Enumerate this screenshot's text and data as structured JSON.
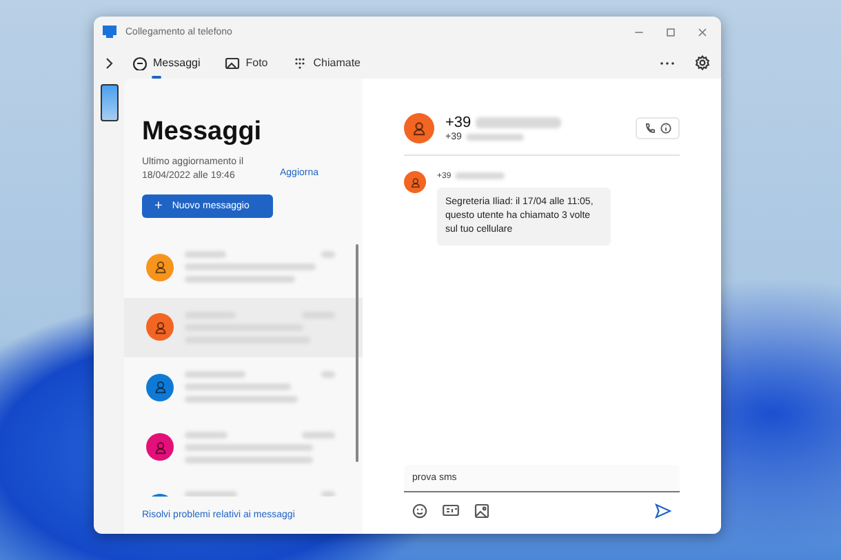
{
  "window": {
    "title": "Collegamento al telefono"
  },
  "tabs": [
    {
      "label": "Messaggi",
      "kind": "chat",
      "selected": true
    },
    {
      "label": "Foto",
      "kind": "photo",
      "selected": false
    },
    {
      "label": "Chiamate",
      "kind": "dialpad",
      "selected": false
    }
  ],
  "messages_pane": {
    "heading": "Messaggi",
    "updated": "Ultimo aggiornamento il 18/04/2022 alle 19:46",
    "refresh_link": "Aggiorna",
    "new_button": {
      "icon": "+",
      "label": "Nuovo messaggio"
    },
    "conversations": [
      {
        "color": "#f7941d",
        "selected": false
      },
      {
        "color": "#f26522",
        "selected": true
      },
      {
        "color": "#0f7ad6",
        "selected": false
      },
      {
        "color": "#e3107a",
        "selected": false
      },
      {
        "color": "#0f7ad6",
        "selected": false
      }
    ],
    "help_link": "Risolvi problemi relativi ai messaggi"
  },
  "conversation": {
    "contact_prefix": "+39",
    "contact_sub_prefix": "+39",
    "messages": [
      {
        "sender_prefix": "+39",
        "text": "Segreteria Iliad: il 17/04 alle 11:05, questo utente ha chiamato 3 volte sul tuo cellulare"
      }
    ],
    "composer": {
      "value": "prova sms"
    }
  }
}
